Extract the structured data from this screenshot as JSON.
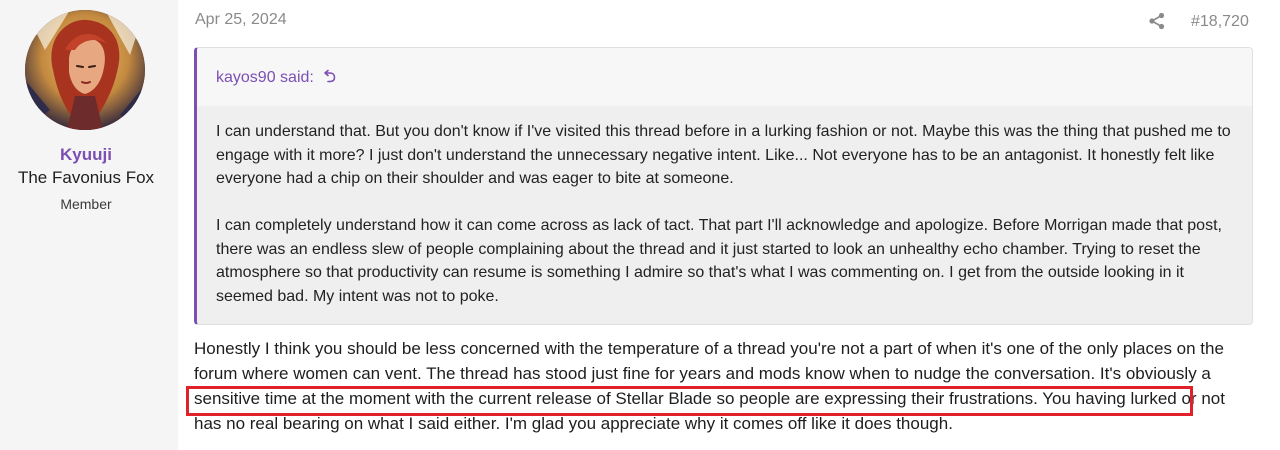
{
  "user": {
    "name": "Kyuuji",
    "title": "The Favonius Fox",
    "role": "Member",
    "avatar_icon": "avatar-portrait"
  },
  "post": {
    "date": "Apr 25, 2024",
    "number": "#18,720",
    "share_icon": "share-icon",
    "quote": {
      "author": "kayos90 said:",
      "jump_icon": "jump-back-icon",
      "paragraphs": [
        "I can understand that. But you don't know if I've visited this thread before in a lurking fashion or not. Maybe this was the thing that pushed me to engage with it more? I just don't understand the unnecessary negative intent. Like... Not everyone has to be an antagonist. It honestly felt like everyone had a chip on their shoulder and was eager to bite at someone.",
        "I can completely understand how it can come across as lack of tact. That part I'll acknowledge and apologize. Before Morrigan made that post, there was an endless slew of people complaining about the thread and it just started to look an unhealthy echo chamber. Trying to reset the atmosphere so that productivity can resume is something I admire so that's what I was commenting on. I get from the outside looking in it seemed bad. My intent was not to poke."
      ]
    },
    "body": "Honestly I think you should be less concerned with the temperature of a thread you're not a part of when it's one of the only places on the forum where women can vent. The thread has stood just fine for years and mods know when to nudge the conversation. It's obviously a sensitive time at the moment with the current release of Stellar Blade so people are expressing their frustrations. You having lurked or not has no real bearing on what I said either. I'm glad you appreciate why it comes off like it does though."
  },
  "colors": {
    "accent": "#7b4fb3",
    "highlight": "#e0212a"
  }
}
